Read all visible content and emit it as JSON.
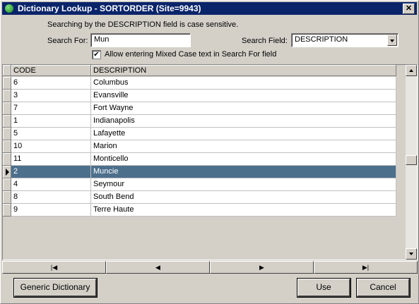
{
  "window": {
    "title": "Dictionary Lookup - SORTORDER (Site=9943)",
    "close_glyph": "✕"
  },
  "search": {
    "note": "Searching by the DESCRIPTION field is case sensitive.",
    "search_for_label": "Search For:",
    "search_for_value": "Mun",
    "search_field_label": "Search Field:",
    "search_field_value": "DESCRIPTION",
    "mixed_case_label": "Allow entering Mixed Case text in Search For field",
    "mixed_case_checked": "✔"
  },
  "grid": {
    "columns": [
      "CODE",
      "DESCRIPTION"
    ],
    "rows": [
      [
        "6",
        "Columbus"
      ],
      [
        "3",
        "Evansville"
      ],
      [
        "7",
        "Fort Wayne"
      ],
      [
        "1",
        "Indianapolis"
      ],
      [
        "5",
        "Lafayette"
      ],
      [
        "10",
        "Marion"
      ],
      [
        "11",
        "Monticello"
      ],
      [
        "2",
        "Muncie"
      ],
      [
        "4",
        "Seymour"
      ],
      [
        "8",
        "South Bend"
      ],
      [
        "9",
        "Terre Haute"
      ]
    ],
    "selected_row_index": 7,
    "selection_color": "#4c6f8c"
  },
  "navigator": {
    "first": "|◀",
    "prior": "◀",
    "next": "▶",
    "last": "▶|"
  },
  "buttons": {
    "generic": "Generic Dictionary",
    "use": "Use",
    "cancel": "Cancel"
  },
  "colors": {
    "titlebar": "#0a246a",
    "face": "#d4d0c8"
  }
}
